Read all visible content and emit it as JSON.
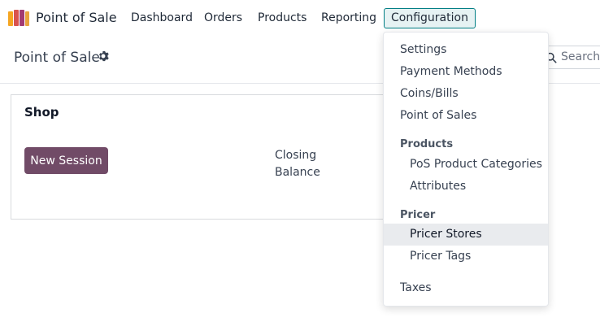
{
  "app": {
    "name": "Point of Sale",
    "logo_colors": [
      "#f5a623",
      "#d9534f",
      "#a23b72",
      "#e8a33d"
    ]
  },
  "nav": {
    "items": [
      "Dashboard",
      "Orders",
      "Products",
      "Reporting",
      "Configuration"
    ],
    "active": "Configuration",
    "active_border_color": "#017e84"
  },
  "control_panel": {
    "title": "Point of Sale",
    "search_placeholder": "Search..."
  },
  "card": {
    "title": "Shop",
    "button_label": "New Session",
    "button_color": "#714b67",
    "closing_label": "Closing Balance"
  },
  "menu": {
    "items_top": [
      "Settings",
      "Payment Methods",
      "Coins/Bills",
      "Point of Sales"
    ],
    "group_products": {
      "header": "Products",
      "items": [
        "PoS Product Categories",
        "Attributes"
      ]
    },
    "group_pricer": {
      "header": "Pricer",
      "items": [
        "Pricer Stores",
        "Pricer Tags"
      ],
      "highlighted": "Pricer Stores"
    },
    "items_bottom": [
      "Taxes"
    ]
  }
}
